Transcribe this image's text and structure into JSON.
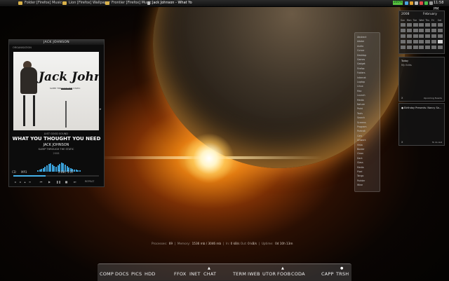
{
  "taskbar": {
    "windows": [
      {
        "label": "Folder [Firefox] Music"
      },
      {
        "label": "Lion [Firefox] Wallpaper"
      },
      {
        "label": "Frontier [Firefox] Music"
      },
      {
        "label": "Jack Johnson - What Yo"
      }
    ],
    "battery_label": "100%",
    "clock": "11:58 PM"
  },
  "player": {
    "title": "JACK JOHNSON",
    "source": "ORGANISATION",
    "album_art_text": "Jack Johnson",
    "album_art_subtitle": "SLEEP THROUGH THE STATIC",
    "sound_label": "JUST GOOD SOUND",
    "track": "WHAT YOU THOUGHT YOU NEED",
    "artist": "JACK JOHNSON",
    "album": "SLEEP THROUGH THE STATIC",
    "year": "2008",
    "time": "2:08 / 5:37",
    "format_icon": "CD",
    "format": "MP3",
    "progress": 0.38,
    "repeat_label": "REPEAT",
    "accent_color": "#45b0e8",
    "controls": [
      "prev-icon",
      "play-icon",
      "pause-icon",
      "stop-icon",
      "next-icon"
    ]
  },
  "vlist": {
    "items": [
      "Abstract",
      "Adobe",
      "Audio",
      "Cursor",
      "Desktop",
      "Games",
      "Gadget",
      "Firefox",
      "Folders",
      "Internet",
      "Laptop",
      "Linux",
      "Mac",
      "Launch",
      "Media",
      "Nature",
      "Paint",
      "Tools",
      "Search",
      "Screens",
      "Program",
      "Portrait",
      "Cars",
      "Artwork",
      "Vista",
      "Border",
      "Clean",
      "Dark",
      "Glass",
      "Media",
      "Pixel",
      "Tango",
      "Pointer",
      "Wine"
    ]
  },
  "calendar": {
    "year": "2008",
    "month": "February",
    "days": [
      "Sun",
      "Mon",
      "Tue",
      "Wed",
      "Thu",
      "Fri",
      "Sat"
    ],
    "today_index": 27
  },
  "gadget_today": {
    "title": "Today",
    "subtitle": "My Edits",
    "footer": "Upcoming Events",
    "close": "X"
  },
  "gadget_birthday": {
    "item": "Birthday Presents: Nancy Sa...",
    "footer": "To do List",
    "close": "X"
  },
  "stats": {
    "processes_label": "Processes:",
    "processes": "69",
    "memory_label": "Memory:",
    "memory": "1536 mb / 3046 mb",
    "in_label": "In:",
    "in": "0 kB/s",
    "out_label": "Out:",
    "out": "0 kB/s",
    "uptime_label": "Uptime:",
    "uptime": "0d 10h 13m"
  },
  "dock": {
    "items": [
      "COMP",
      "DOCS",
      "PICS",
      "HDD",
      "FFOX",
      "INET",
      "CHAT",
      "TERM",
      "IWEB",
      "UTOR",
      "FOOB",
      "CODA",
      "CAPP",
      "TRSH"
    ]
  }
}
